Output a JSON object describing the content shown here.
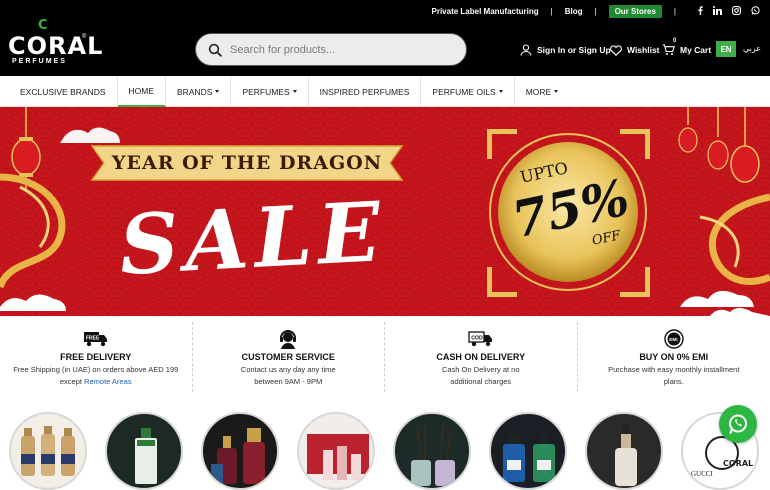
{
  "topbar": {
    "links": {
      "private_label": "Private Label Manufacturing",
      "blog": "Blog",
      "stores": "Our Stores"
    },
    "social": [
      "f",
      "in",
      "ig",
      "wa"
    ],
    "social_icons": [
      "facebook-icon",
      "linkedin-icon",
      "instagram-icon",
      "whatsapp-icon"
    ]
  },
  "logo": {
    "top": "C",
    "main": "CORAL",
    "sub": "PERFUMES",
    "mark": "®"
  },
  "search": {
    "placeholder": "Search for products..."
  },
  "account": {
    "signin": "Sign In or Sign Up",
    "wishlist": "Wishlist",
    "cart_label": "My Cart",
    "cart_count": "0",
    "lang_en": "EN",
    "lang_ar": "عربي"
  },
  "nav": {
    "items": [
      {
        "label": "EXCLUSIVE BRANDS",
        "caret": false,
        "active": false
      },
      {
        "label": "HOME",
        "caret": false,
        "active": true
      },
      {
        "label": "BRANDS",
        "caret": true,
        "active": false
      },
      {
        "label": "PERFUMES",
        "caret": true,
        "active": false
      },
      {
        "label": "INSPIRED PERFUMES",
        "caret": false,
        "active": false
      },
      {
        "label": "PERFUME OILS",
        "caret": true,
        "active": false
      },
      {
        "label": "MORE",
        "caret": true,
        "active": false
      }
    ]
  },
  "banner": {
    "tagline": "YEAR OF THE DRAGON",
    "headline": "SALE",
    "upto": "UPTO",
    "discount": "75%",
    "off": "OFF"
  },
  "features": [
    {
      "title": "FREE DELIVERY",
      "desc": "Free Shipping (in UAE) on orders above AED 199 except ",
      "link": "Remote Areas",
      "icon": "delivery-truck-icon"
    },
    {
      "title": "CUSTOMER SERVICE",
      "desc": "Contact us any day any time between 9AM - 9PM",
      "link": "",
      "icon": "headset-agent-icon"
    },
    {
      "title": "CASH ON DELIVERY",
      "desc": "Cash On Delivery at no additional charges",
      "link": "",
      "icon": "cod-truck-icon"
    },
    {
      "title": "BUY ON 0% EMI",
      "desc": "Purchase with easy monthly installment plans.",
      "link": "",
      "icon": "emi-badge-icon"
    }
  ],
  "categories": [
    "category-gift-sets",
    "category-green-bottle",
    "category-ornate-bottles",
    "category-gift-box",
    "category-reed-diffusers",
    "category-blue-green-bottles",
    "category-serum-bottle",
    "category-gucci-brand"
  ],
  "colors": {
    "topbar_bg": "#000000",
    "brand_green": "#3fae49",
    "banner_red": "#c8161d",
    "gold": "#e8c35a",
    "whatsapp": "#2bb741"
  }
}
